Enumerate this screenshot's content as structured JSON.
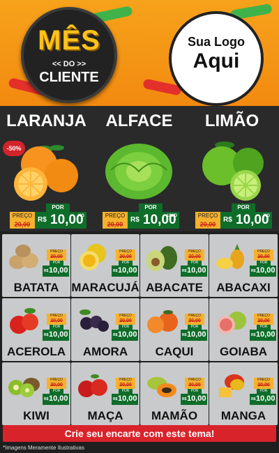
{
  "header": {
    "badge": {
      "line1": "MÊS",
      "line2": "<< DO >>",
      "line3": "CLIENTE"
    },
    "logo": {
      "line1": "Sua Logo",
      "line2": "Aqui"
    }
  },
  "featured": [
    {
      "name": "LARANJA",
      "discount": "-50%",
      "old_label": "PREÇO",
      "old_price": "20,00",
      "por": "POR",
      "currency": "R$",
      "price": "10,00",
      "unit": "KG"
    },
    {
      "name": "ALFACE",
      "old_label": "PREÇO",
      "old_price": "20,00",
      "por": "POR",
      "currency": "R$",
      "price": "10,00",
      "unit": "UNID"
    },
    {
      "name": "LIMÃO",
      "old_label": "PREÇO",
      "old_price": "20,00",
      "por": "POR",
      "currency": "R$",
      "price": "10,00",
      "unit": "KG"
    }
  ],
  "products": [
    {
      "name": "BATATA",
      "old_label": "PREÇO",
      "old_price": "20,00",
      "por": "POR",
      "currency": "R$",
      "price": "10,00"
    },
    {
      "name": "MARACUJÁ",
      "old_label": "PREÇO",
      "old_price": "20,00",
      "por": "POR",
      "currency": "R$",
      "price": "10,00"
    },
    {
      "name": "ABACATE",
      "old_label": "PREÇO",
      "old_price": "20,00",
      "por": "POR",
      "currency": "R$",
      "price": "10,00"
    },
    {
      "name": "ABACAXI",
      "old_label": "PREÇO",
      "old_price": "20,00",
      "por": "POR",
      "currency": "R$",
      "price": "10,00"
    },
    {
      "name": "ACEROLA",
      "old_label": "PREÇO",
      "old_price": "20,00",
      "por": "POR",
      "currency": "R$",
      "price": "10,00"
    },
    {
      "name": "AMORA",
      "old_label": "PREÇO",
      "old_price": "20,00",
      "por": "POR",
      "currency": "R$",
      "price": "10,00"
    },
    {
      "name": "CAQUI",
      "old_label": "PREÇO",
      "old_price": "20,00",
      "por": "POR",
      "currency": "R$",
      "price": "10,00"
    },
    {
      "name": "GOIABA",
      "old_label": "PREÇO",
      "old_price": "20,00",
      "por": "POR",
      "currency": "R$",
      "price": "10,00"
    },
    {
      "name": "KIWI",
      "old_label": "PREÇO",
      "old_price": "20,00",
      "por": "POR",
      "currency": "R$",
      "price": "10,00"
    },
    {
      "name": "MAÇA",
      "old_label": "PREÇO",
      "old_price": "20,00",
      "por": "POR",
      "currency": "R$",
      "price": "10,00"
    },
    {
      "name": "MAMÃO",
      "old_label": "PREÇO",
      "old_price": "20,00",
      "por": "POR",
      "currency": "R$",
      "price": "10,00"
    },
    {
      "name": "MANGA",
      "old_label": "PREÇO",
      "old_price": "20,00",
      "por": "POR",
      "currency": "R$",
      "price": "10,00"
    }
  ],
  "banner": "Crie seu encarte com este tema!",
  "footnote": "*Imagens Meramente Ilustrativas",
  "colors": {
    "orange": "#f28a10",
    "green": "#0f6d2a",
    "red": "#d9232b",
    "gold": "#f6b12e"
  }
}
